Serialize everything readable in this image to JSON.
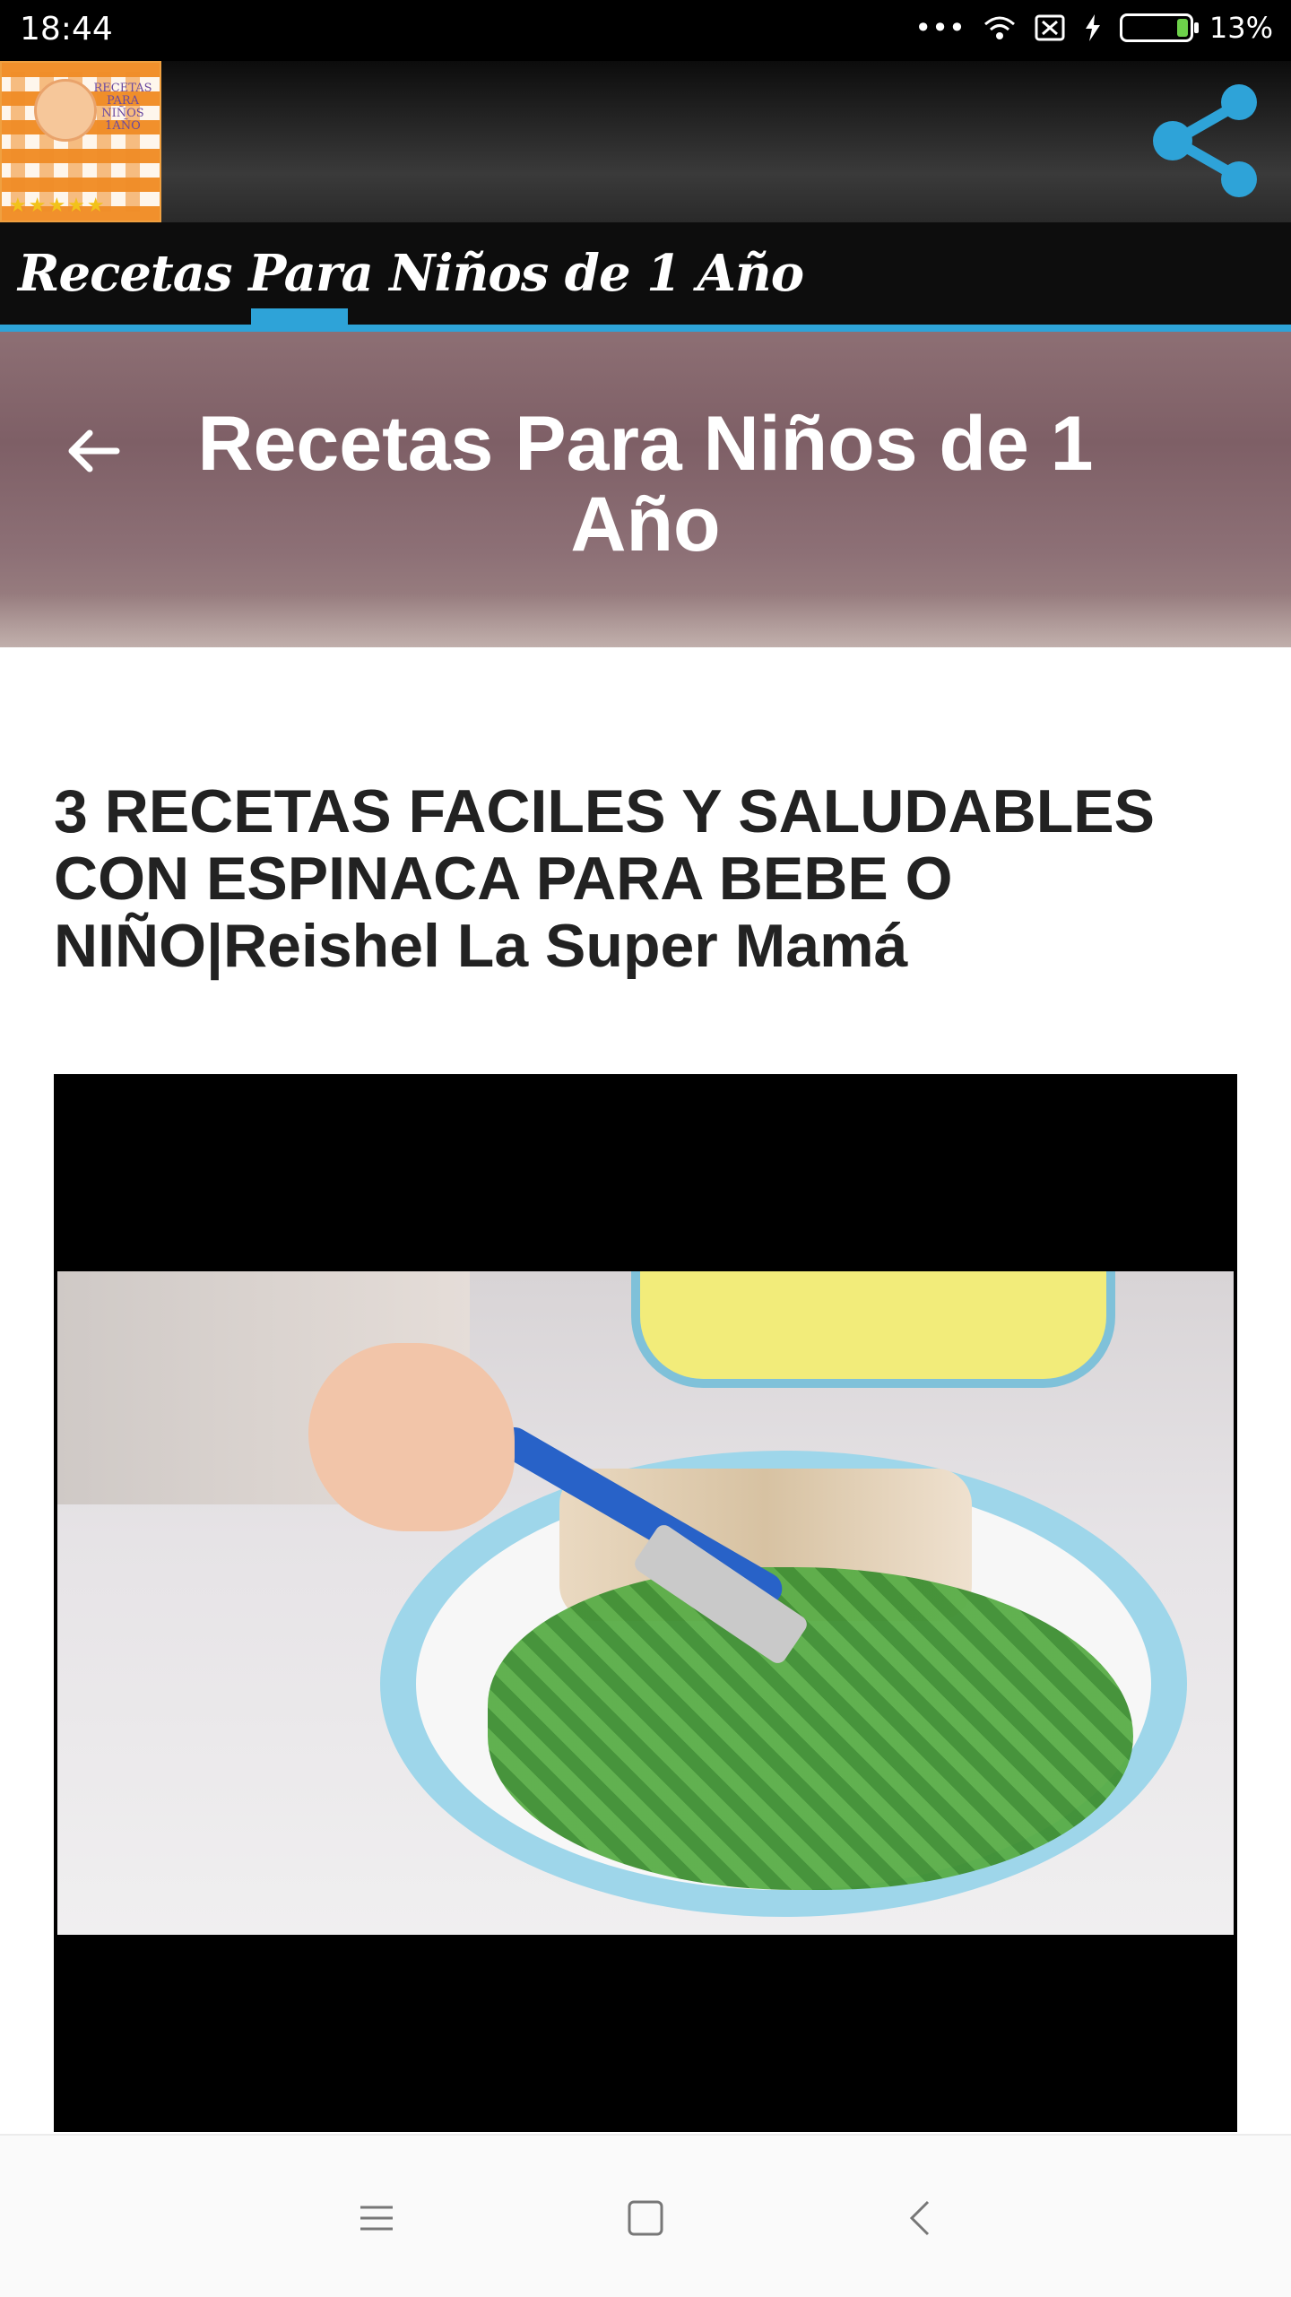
{
  "status_bar": {
    "time": "18:44",
    "battery_text": "13%",
    "icons": [
      "more-dots-icon",
      "wifi-icon",
      "sim-blocked-icon",
      "charging-bolt-icon",
      "battery-icon"
    ],
    "battery_level": 0.13
  },
  "app_header": {
    "logo_text": "RECETAS PARA NIÑOS 1AÑO",
    "logo_stars": "★★★★★",
    "share_icon": "share-icon"
  },
  "tab_strip": {
    "title": "Recetas Para Niños de 1 Año",
    "accent_color": "#2ea3d8"
  },
  "hero": {
    "back_icon": "arrow-left-icon",
    "title": "Recetas Para Niños de 1 Año"
  },
  "article": {
    "title": "3 RECETAS FACILES Y SALUDABLES CON ESPINACA PARA BEBE O NIÑO|Reishel La Super Mamá"
  },
  "nav_bar": {
    "icons": [
      "menu-icon",
      "home-square-icon",
      "back-chevron-icon"
    ]
  }
}
